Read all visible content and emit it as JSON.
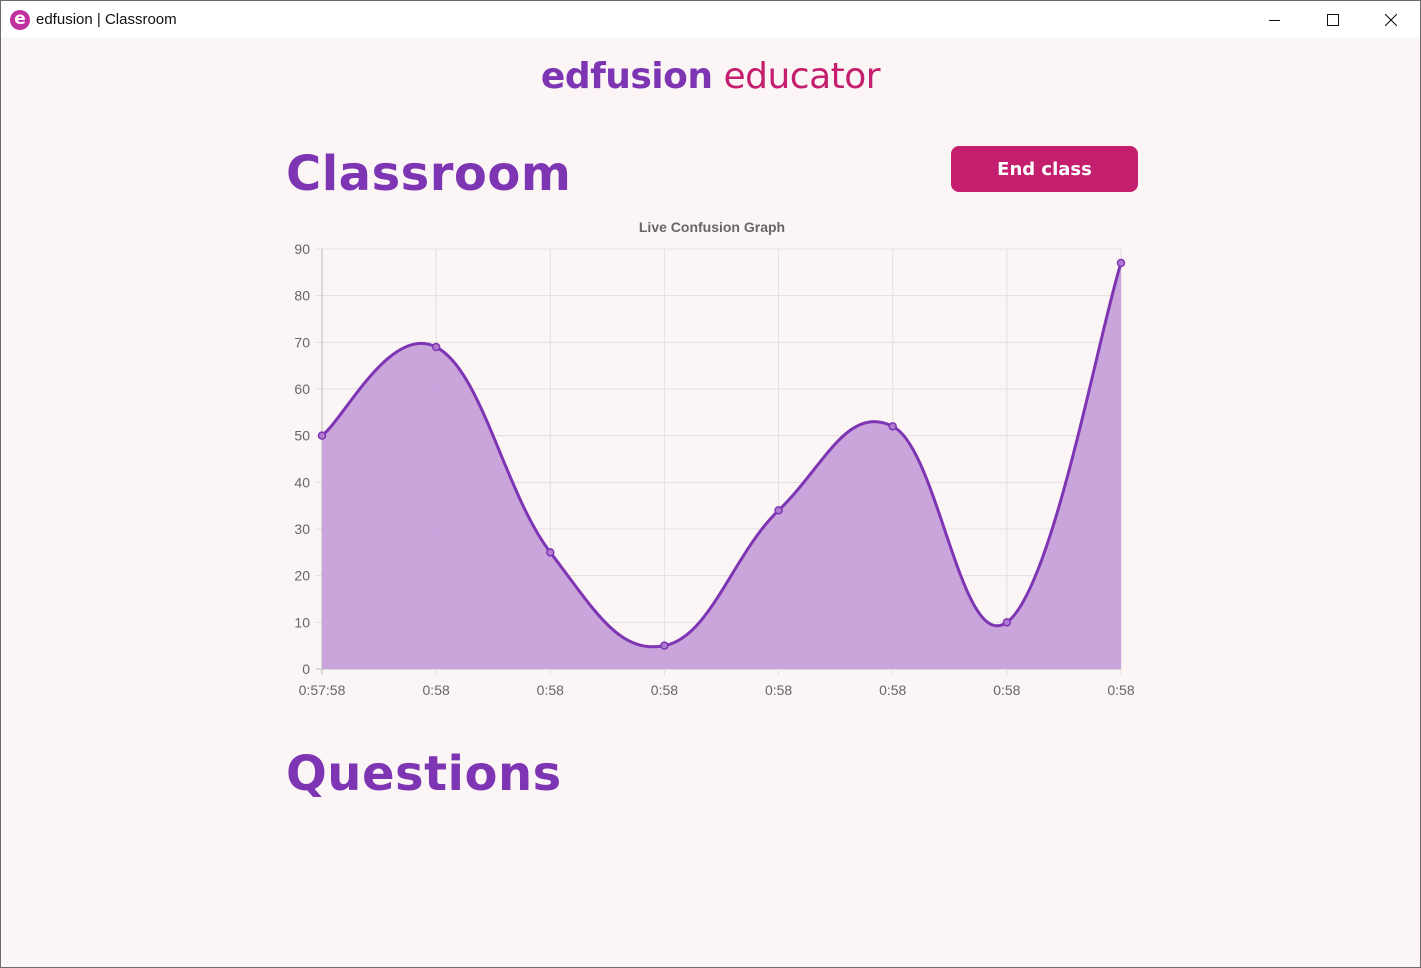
{
  "window": {
    "title": "edfusion | Classroom",
    "icon": "edfusion-logo-icon",
    "controls": [
      "minimize-icon",
      "maximize-icon",
      "close-icon"
    ]
  },
  "header": {
    "brand_primary": "edfusion",
    "brand_secondary": "educator"
  },
  "main": {
    "classroom_heading": "Classroom",
    "end_class_label": "End class",
    "questions_heading": "Questions"
  },
  "colors": {
    "purple": "#7e35b3",
    "magenta": "#c41f6e",
    "area_fill": "#c6a0da",
    "background": "#fcf5f5"
  },
  "chart_data": {
    "type": "area",
    "title": "Live Confusion Graph",
    "x": [
      "0:57:58",
      "0:58",
      "0:58",
      "0:58",
      "0:58",
      "0:58",
      "0:58",
      "0:58"
    ],
    "values": [
      50,
      69,
      25,
      5,
      34,
      52,
      10,
      87
    ],
    "ylim": [
      0,
      90
    ],
    "yticks": [
      0,
      10,
      20,
      30,
      40,
      50,
      60,
      70,
      80,
      90
    ],
    "grid": true,
    "smooth": true
  }
}
